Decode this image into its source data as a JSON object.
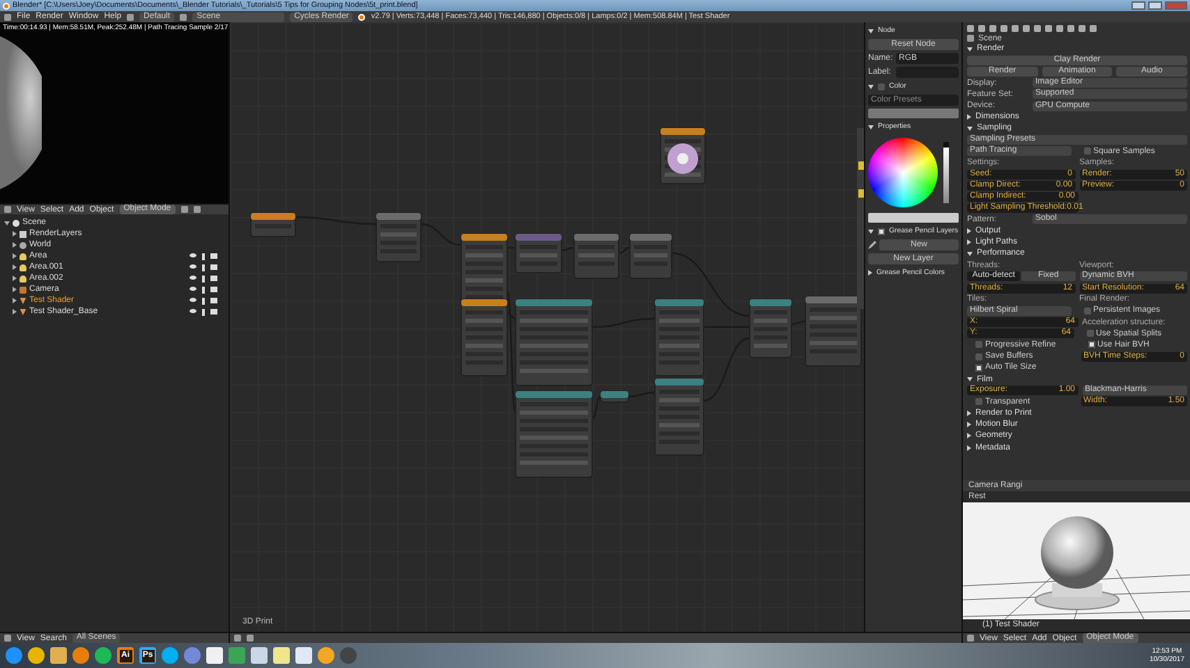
{
  "window": {
    "title": "Blender* [C:\\Users\\Joey\\Documents\\Documents\\_Blender Tutorials\\_Tutorials\\5 Tips for Grouping Nodes\\5t_print.blend]"
  },
  "info_header": {
    "menus": [
      "File",
      "Render",
      "Window",
      "Help"
    ],
    "layout": "Default",
    "scene": "Scene",
    "engine": "Cycles Render",
    "stats": "v2.79 | Verts:73,448 | Faces:73,440 | Tris:146,880 | Objects:0/8 | Lamps:0/2 | Mem:508.84M | Test Shader"
  },
  "viewport": {
    "status": "Time:00:14.93 | Mem:58.51M, Peak:252.48M | Path Tracing Sample 2/17",
    "menus": [
      "View",
      "Select",
      "Add",
      "Object"
    ],
    "mode": "Object Mode"
  },
  "outliner": {
    "tree": [
      {
        "label": "Scene",
        "kind": "scene",
        "expanded": true,
        "selected": false,
        "children": [
          {
            "label": "RenderLayers",
            "kind": "renderlayers",
            "expanded": false,
            "selected": false
          },
          {
            "label": "World",
            "kind": "world",
            "expanded": false,
            "selected": false
          },
          {
            "label": "Area",
            "kind": "lamp",
            "expanded": false,
            "selected": false
          },
          {
            "label": "Area.001",
            "kind": "lamp",
            "expanded": false,
            "selected": false
          },
          {
            "label": "Area.002",
            "kind": "lamp",
            "expanded": false,
            "selected": false
          },
          {
            "label": "Camera",
            "kind": "camera",
            "expanded": false,
            "selected": false
          },
          {
            "label": "Test Shader",
            "kind": "mesh",
            "expanded": false,
            "selected": true
          },
          {
            "label": "Test Shader_Base",
            "kind": "mesh",
            "expanded": false,
            "selected": false
          }
        ]
      }
    ],
    "footer_menus": [
      "View",
      "Search"
    ],
    "filter": "All Scenes"
  },
  "node_editor": {
    "frame_label": "3D Print"
  },
  "n_panel": {
    "node_section": {
      "label": "Node",
      "expanded": true
    },
    "reset": "Reset Node",
    "name_label": "Name:",
    "name": "RGB",
    "label_label": "Label:",
    "color_section": {
      "label": "Color",
      "expanded": true
    },
    "use_color": false,
    "color_presets": "Color Presets",
    "properties_section": {
      "label": "Properties",
      "expanded": true
    },
    "value_slider": {
      "level": 0.92
    },
    "gp_layers": {
      "label": "Grease Pencil Layers",
      "expanded": true,
      "checked": true
    },
    "new": "New",
    "new_layer": "New Layer",
    "gp_colors": {
      "label": "Grease Pencil Colors",
      "expanded": false
    }
  },
  "properties": {
    "breadcrumb": "Scene",
    "rows": [
      [
        {
          "kind": "section",
          "label": "Render",
          "expanded": true
        }
      ],
      [
        {
          "kind": "button",
          "label": "Clay Render"
        }
      ],
      [
        {
          "kind": "button",
          "label": "Render"
        },
        {
          "kind": "button",
          "label": "Animation"
        },
        {
          "kind": "button",
          "label": "Audio"
        }
      ],
      [
        {
          "kind": "dropdown",
          "label": "Display:",
          "value": "Image Editor"
        }
      ],
      [
        {
          "kind": "dropdown",
          "label": "Feature Set:",
          "value": "Supported"
        }
      ],
      [
        {
          "kind": "dropdown",
          "label": "Device:",
          "value": "GPU Compute"
        }
      ],
      [
        {
          "kind": "section",
          "label": "Dimensions",
          "expanded": false
        }
      ],
      [
        {
          "kind": "section",
          "label": "Sampling",
          "expanded": true
        }
      ],
      [
        {
          "kind": "dropdown",
          "value": "Sampling Presets"
        }
      ],
      [
        {
          "kind": "dropdown",
          "value": "Path Tracing"
        },
        {
          "kind": "check",
          "label": "Square Samples",
          "checked": false
        }
      ],
      [
        {
          "kind": "label",
          "label": "Settings:"
        },
        {
          "kind": "label",
          "label": "Samples:"
        }
      ],
      [
        {
          "kind": "number",
          "label": "Seed:",
          "value": "0"
        },
        {
          "kind": "number",
          "label": "Render:",
          "value": "50"
        }
      ],
      [
        {
          "kind": "number",
          "label": "Clamp Direct:",
          "value": "0.00"
        },
        {
          "kind": "number",
          "label": "Preview:",
          "value": "0"
        }
      ],
      [
        {
          "kind": "number",
          "label": "Clamp Indirect:",
          "value": "0.00"
        },
        {
          "kind": "blank"
        }
      ],
      [
        {
          "kind": "number",
          "label": "Light Sampling Threshold:",
          "value": "0.01"
        },
        {
          "kind": "blank"
        }
      ],
      [
        {
          "kind": "dropdown",
          "label": "Pattern:",
          "value": "Sobol"
        }
      ],
      [
        {
          "kind": "section",
          "label": "Output",
          "expanded": false
        }
      ],
      [
        {
          "kind": "section",
          "label": "Light Paths",
          "expanded": false
        }
      ],
      [
        {
          "kind": "section",
          "label": "Performance",
          "expanded": true
        }
      ],
      [
        {
          "kind": "label",
          "label": "Threads:"
        },
        {
          "kind": "label",
          "label": "Viewport:"
        }
      ],
      [
        {
          "kind": "radio",
          "options": [
            {
              "label": "Auto-detect",
              "selected": true
            },
            {
              "label": "Fixed",
              "selected": false
            }
          ]
        },
        {
          "kind": "dropdown",
          "value": "Dynamic BVH"
        }
      ],
      [
        {
          "kind": "number",
          "label": "Threads:",
          "value": "12"
        },
        {
          "kind": "number",
          "label": "Start Resolution:",
          "value": "64"
        }
      ],
      [
        {
          "kind": "label",
          "label": "Tiles:"
        },
        {
          "kind": "label",
          "label": "Final Render:"
        }
      ],
      [
        {
          "kind": "dropdown",
          "value": "Hilbert Spiral"
        },
        {
          "kind": "check",
          "label": "Persistent Images",
          "checked": false
        }
      ],
      [
        {
          "kind": "number",
          "label": "X:",
          "value": "64"
        },
        {
          "kind": "label",
          "label": "Acceleration structure:"
        }
      ],
      [
        {
          "kind": "number",
          "label": "Y:",
          "value": "64"
        },
        {
          "kind": "check",
          "label": "Use Spatial Splits",
          "checked": false
        }
      ],
      [
        {
          "kind": "check",
          "label": "Progressive Refine",
          "checked": false
        },
        {
          "kind": "check",
          "label": "Use Hair BVH",
          "checked": true
        }
      ],
      [
        {
          "kind": "check",
          "label": "Save Buffers",
          "checked": false
        },
        {
          "kind": "number",
          "label": "BVH Time Steps:",
          "value": "0"
        }
      ],
      [
        {
          "kind": "check",
          "label": "Auto Tile Size",
          "checked": true
        }
      ],
      [
        {
          "kind": "section",
          "label": "Film",
          "expanded": true
        }
      ],
      [
        {
          "kind": "number",
          "label": "Exposure:",
          "value": "1.00"
        },
        {
          "kind": "dropdown",
          "value": "Blackman-Harris"
        }
      ],
      [
        {
          "kind": "check",
          "label": "Transparent",
          "checked": false
        },
        {
          "kind": "number",
          "label": "Width:",
          "value": "1.50"
        }
      ],
      [
        {
          "kind": "section",
          "label": "Render to Print",
          "expanded": false
        }
      ],
      [
        {
          "kind": "section",
          "label": "Motion Blur",
          "expanded": false
        }
      ],
      [
        {
          "kind": "section",
          "label": "Geometry",
          "expanded": false
        }
      ],
      [
        {
          "kind": "section",
          "label": "Metadata",
          "expanded": false
        }
      ]
    ]
  },
  "preview": {
    "title": "Camera Rangi",
    "subtitle": "Rest",
    "caption": "(1) Test Shader"
  },
  "view3d_header": {
    "menus": [
      "View",
      "Select",
      "Add",
      "Object"
    ],
    "mode": "Object Mode"
  },
  "taskbar": {
    "apps": [
      {
        "kind": "circle",
        "color": "#1e90ff"
      },
      {
        "kind": "circle",
        "color": "#e8b400"
      },
      {
        "kind": "tile",
        "color": "#e0b050"
      },
      {
        "kind": "circle",
        "color": "#e87d0d"
      },
      {
        "kind": "circle",
        "color": "#1db954"
      },
      {
        "kind": "tile",
        "color": "#e87d0d",
        "label": "Ai"
      },
      {
        "kind": "tile",
        "color": "#31a8ff",
        "label": "Ps"
      },
      {
        "kind": "circle",
        "color": "#00aff0"
      },
      {
        "kind": "circle",
        "color": "#7289da"
      },
      {
        "kind": "tile",
        "color": "#f0f0f0"
      },
      {
        "kind": "tile",
        "color": "#3aa655"
      },
      {
        "kind": "tile",
        "color": "#c9d7e6"
      },
      {
        "kind": "tile",
        "color": "#f0e68c"
      },
      {
        "kind": "tile",
        "color": "#dfe9f5"
      },
      {
        "kind": "circle",
        "color": "#f5a623"
      },
      {
        "kind": "circle",
        "color": "#444444"
      }
    ],
    "time": "12:53 PM",
    "date": "10/30/2017"
  }
}
